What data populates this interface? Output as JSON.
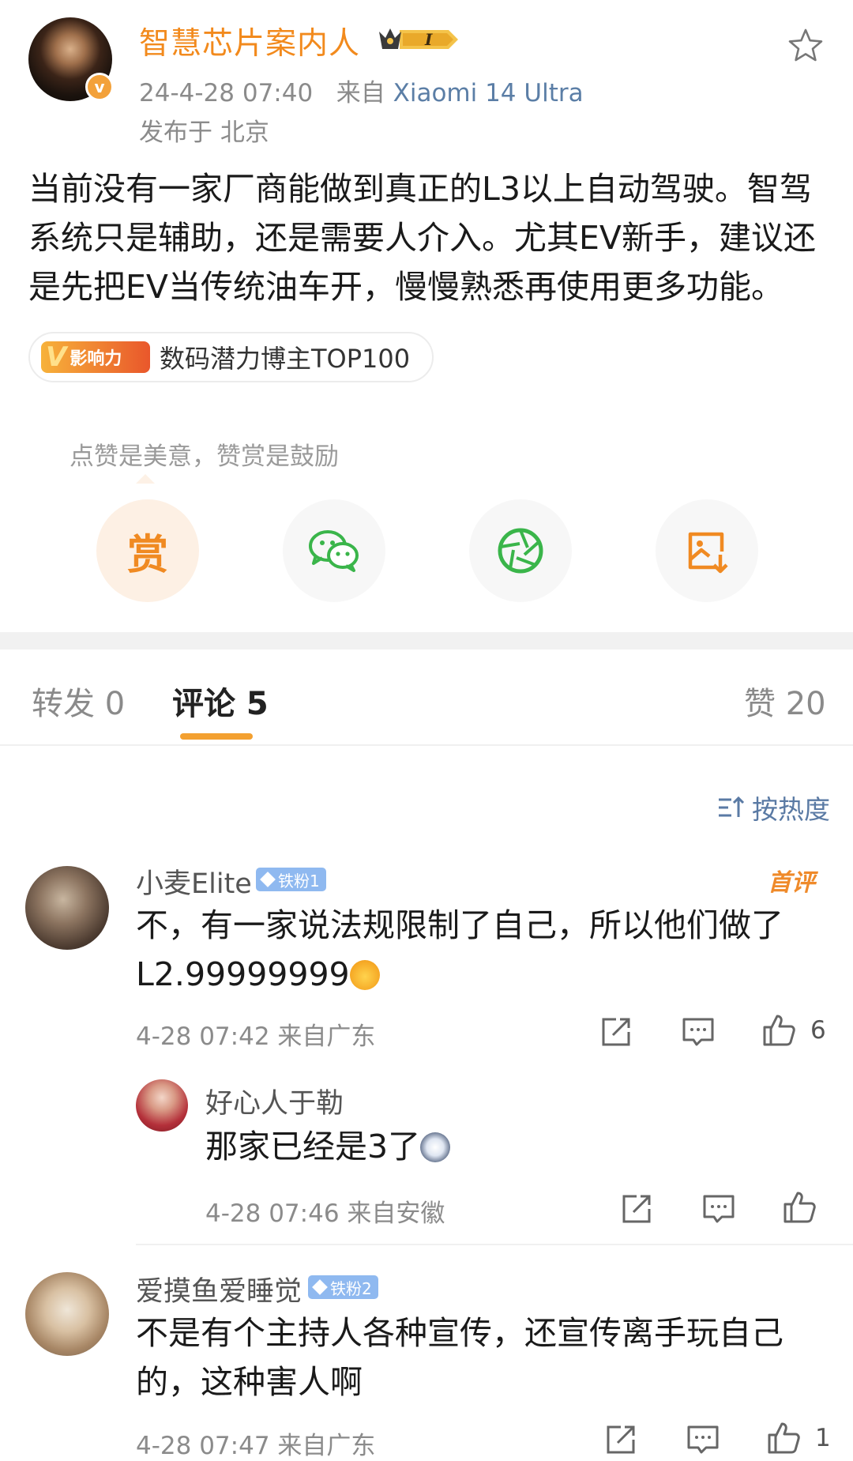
{
  "post": {
    "author": "智慧芯片案内人",
    "level": "I",
    "date": "24-4-28 07:40",
    "source_prefix": "来自",
    "device": "Xiaomi 14 Ultra",
    "location": "发布于 北京",
    "content": "当前没有一家厂商能做到真正的L3以上自动驾驶。智驾系统只是辅助，还是需要人介入。尤其EV新手，建议还是先把EV当传统油车开，慢慢熟悉再使用更多功能。",
    "tag_badge": "影响力",
    "tag_label": "数码潜力博主TOP100",
    "reward_hint": "点赞是美意，赞赏是鼓励",
    "reward_button": "赏"
  },
  "tabs": {
    "repost": "转发 0",
    "comments": "评论 5",
    "likes": "赞 20"
  },
  "sort_label": "按热度",
  "comments": [
    {
      "user": "小麦Elite",
      "fan_badge": "铁粉1",
      "first_badge": "首评",
      "text_line1": "不，有一家说法规限制了自己，所以他们做了",
      "text_line2": "L2.99999999",
      "meta": "4-28 07:42  来自广东",
      "likes": "6"
    },
    {
      "user": "好心人于勒",
      "text": "那家已经是3了",
      "meta": "4-28 07:46  来自安徽",
      "likes": ""
    },
    {
      "user": "爱摸鱼爱睡觉",
      "fan_badge": "铁粉2",
      "text_line1": "不是有个主持人各种宣传，还宣传离手玩自己",
      "text_line2": "的，这种害人啊",
      "meta": "4-28 07:47  来自广东",
      "likes": "1"
    }
  ],
  "icons": {
    "star": "star-outline-icon",
    "wechat": "wechat-icon",
    "moments": "moments-shutter-icon",
    "save_image": "save-image-icon",
    "share": "share-icon",
    "comment": "comment-icon",
    "like": "thumbs-up-icon",
    "sort": "sort-icon"
  },
  "colors": {
    "accent": "#f3a030",
    "username": "#f28a1d",
    "link": "#5b7ea6",
    "wechat_green": "#3ab54a",
    "badge_blue": "#8fb9f0"
  }
}
